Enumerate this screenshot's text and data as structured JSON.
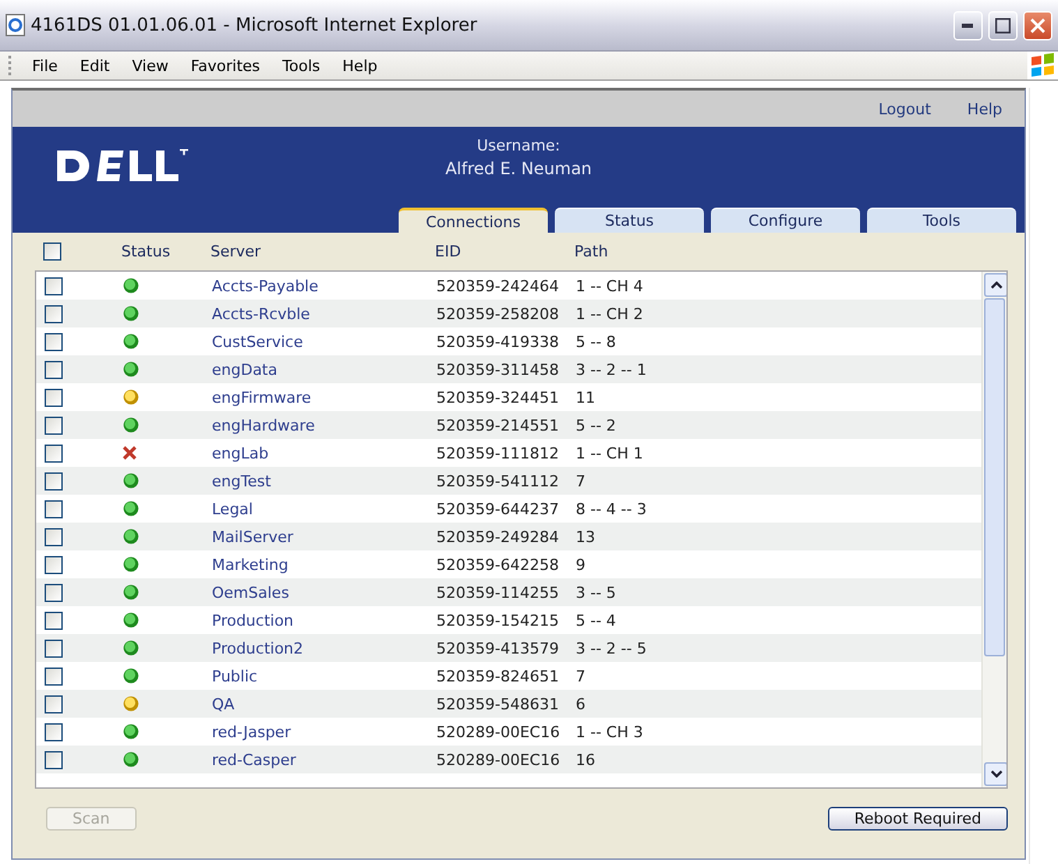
{
  "window": {
    "title": "4161DS 01.01.06.01 - Microsoft Internet Explorer"
  },
  "menu": [
    "File",
    "Edit",
    "View",
    "Favorites",
    "Tools",
    "Help"
  ],
  "top_links": [
    "Logout",
    "Help"
  ],
  "user": {
    "label": "Username:",
    "name": "Alfred E. Neuman"
  },
  "tabs": [
    {
      "label": "Connections",
      "selected": true
    },
    {
      "label": "Status",
      "selected": false
    },
    {
      "label": "Configure",
      "selected": false
    },
    {
      "label": "Tools",
      "selected": false
    }
  ],
  "table": {
    "select_all": {
      "checked": false
    },
    "columns": [
      "Status",
      "Server",
      "EID",
      "Path"
    ],
    "rows": [
      {
        "checked": false,
        "kind": "ok",
        "server": "Accts-Payable",
        "eid": "520359-242464",
        "path": "1 -- CH 4"
      },
      {
        "checked": false,
        "kind": "ok",
        "server": "Accts-Rcvble",
        "eid": "520359-258208",
        "path": "1 -- CH 2"
      },
      {
        "checked": false,
        "kind": "ok",
        "server": "CustService",
        "eid": "520359-419338",
        "path": "5 -- 8"
      },
      {
        "checked": false,
        "kind": "ok",
        "server": "engData",
        "eid": "520359-311458",
        "path": "3 -- 2 -- 1"
      },
      {
        "checked": false,
        "kind": "warning",
        "server": "engFirmware",
        "eid": "520359-324451",
        "path": "11"
      },
      {
        "checked": false,
        "kind": "ok",
        "server": "engHardware",
        "eid": "520359-214551",
        "path": "5 -- 2"
      },
      {
        "checked": false,
        "kind": "error",
        "server": "engLab",
        "eid": "520359-111812",
        "path": "1 -- CH 1"
      },
      {
        "checked": false,
        "kind": "ok",
        "server": "engTest",
        "eid": "520359-541112",
        "path": "7"
      },
      {
        "checked": false,
        "kind": "ok",
        "server": "Legal",
        "eid": "520359-644237",
        "path": "8 -- 4 -- 3"
      },
      {
        "checked": false,
        "kind": "ok",
        "server": "MailServer",
        "eid": "520359-249284",
        "path": "13"
      },
      {
        "checked": false,
        "kind": "ok",
        "server": "Marketing",
        "eid": "520359-642258",
        "path": "9"
      },
      {
        "checked": false,
        "kind": "ok",
        "server": "OemSales",
        "eid": "520359-114255",
        "path": "3 -- 5"
      },
      {
        "checked": false,
        "kind": "ok",
        "server": "Production",
        "eid": "520359-154215",
        "path": "5 -- 4"
      },
      {
        "checked": false,
        "kind": "ok",
        "server": "Production2",
        "eid": "520359-413579",
        "path": "3 -- 2 -- 5"
      },
      {
        "checked": false,
        "kind": "ok",
        "server": "Public",
        "eid": "520359-824651",
        "path": "7"
      },
      {
        "checked": false,
        "kind": "warning",
        "server": "QA",
        "eid": "520359-548631",
        "path": "6"
      },
      {
        "checked": false,
        "kind": "ok",
        "server": "red-Jasper",
        "eid": "520289-00EC16",
        "path": "1 -- CH 3"
      },
      {
        "checked": false,
        "kind": "ok",
        "server": "red-Casper",
        "eid": "520289-00EC16",
        "path": "16"
      }
    ]
  },
  "buttons": [
    {
      "label": "Scan",
      "disabled": true
    },
    {
      "label": "Reboot Required",
      "disabled": false
    }
  ]
}
